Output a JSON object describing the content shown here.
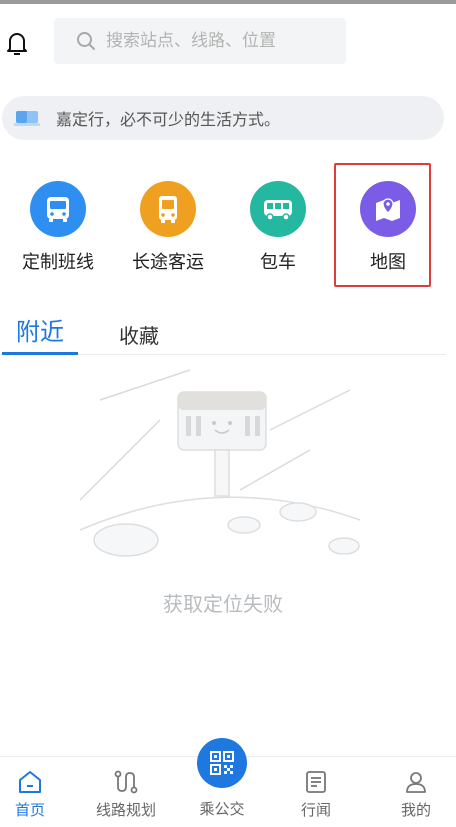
{
  "search": {
    "placeholder": "搜索站点、线路、位置"
  },
  "notice": {
    "text": "嘉定行，必不可少的生活方式。"
  },
  "services": [
    {
      "label": "定制班线",
      "icon": "bus-icon",
      "color": "#2f8ff0"
    },
    {
      "label": "长途客运",
      "icon": "coach-icon",
      "color": "#f0a020"
    },
    {
      "label": "包车",
      "icon": "van-icon",
      "color": "#25b8a0"
    },
    {
      "label": "地图",
      "icon": "map-pin-icon",
      "color": "#7b5ce6"
    }
  ],
  "tabs": {
    "nearby": "附近",
    "favorites": "收藏"
  },
  "empty_state": {
    "text": "获取定位失败"
  },
  "bottom_nav": {
    "home": "首页",
    "route_planning": "线路规划",
    "ride_bus": "乘公交",
    "news": "行闻",
    "mine": "我的"
  },
  "colors": {
    "accent": "#1f78e0",
    "highlight": "#e03c3c"
  }
}
